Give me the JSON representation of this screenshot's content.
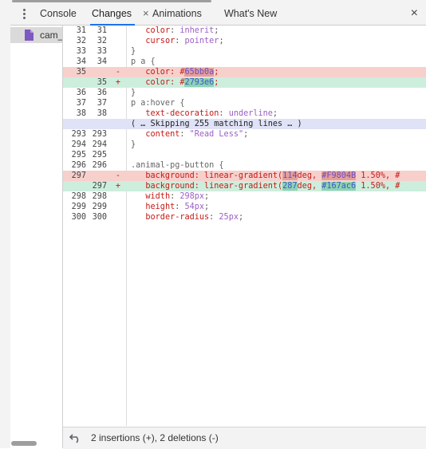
{
  "tabs": {
    "console": "Console",
    "changes": "Changes",
    "changes_close": "×",
    "animations": "Animations",
    "whats_new": "What's New",
    "panel_close": "×"
  },
  "sidebar": {
    "file_name": "cam_"
  },
  "diff_lines": [
    {
      "type": "context",
      "old": "31",
      "new": "31",
      "parts": [
        [
          "   ",
          ""
        ],
        [
          "color",
          "prop"
        ],
        [
          ": ",
          ""
        ],
        [
          "inherit",
          "val"
        ],
        [
          ";",
          ""
        ]
      ]
    },
    {
      "type": "context",
      "old": "32",
      "new": "32",
      "parts": [
        [
          "   ",
          ""
        ],
        [
          "cursor",
          "prop"
        ],
        [
          ": ",
          ""
        ],
        [
          "pointer",
          "val"
        ],
        [
          ";",
          ""
        ]
      ]
    },
    {
      "type": "context",
      "old": "33",
      "new": "33",
      "parts": [
        [
          "}",
          ""
        ]
      ]
    },
    {
      "type": "context",
      "old": "34",
      "new": "34",
      "parts": [
        [
          "p a {",
          "sel"
        ]
      ]
    },
    {
      "type": "del",
      "old": "35",
      "new": "",
      "marker": "-",
      "parts": [
        [
          "   color: #",
          ""
        ],
        [
          "65bb0a",
          "hl-del"
        ],
        [
          ";",
          ""
        ]
      ]
    },
    {
      "type": "add",
      "old": "",
      "new": "35",
      "marker": "+",
      "parts": [
        [
          "   color: #",
          ""
        ],
        [
          "2793e6",
          "hl-add"
        ],
        [
          ";",
          ""
        ]
      ]
    },
    {
      "type": "context",
      "old": "36",
      "new": "36",
      "parts": [
        [
          "}",
          ""
        ]
      ]
    },
    {
      "type": "context",
      "old": "37",
      "new": "37",
      "parts": [
        [
          "p a:hover {",
          "sel"
        ]
      ]
    },
    {
      "type": "context",
      "old": "38",
      "new": "38",
      "parts": [
        [
          "   ",
          ""
        ],
        [
          "text-decoration",
          "prop"
        ],
        [
          ": ",
          ""
        ],
        [
          "underline",
          "val"
        ],
        [
          ";",
          ""
        ]
      ]
    },
    {
      "type": "skip",
      "old": "",
      "new": "",
      "parts": [
        [
          "( … Skipping 255 matching lines … )",
          ""
        ]
      ]
    },
    {
      "type": "context",
      "old": "293",
      "new": "293",
      "parts": [
        [
          "   ",
          ""
        ],
        [
          "content",
          "prop"
        ],
        [
          ": ",
          ""
        ],
        [
          "\"Read Less\"",
          "str"
        ],
        [
          ";",
          ""
        ]
      ]
    },
    {
      "type": "context",
      "old": "294",
      "new": "294",
      "parts": [
        [
          "}",
          ""
        ]
      ]
    },
    {
      "type": "context",
      "old": "295",
      "new": "295",
      "parts": [
        [
          "",
          ""
        ]
      ]
    },
    {
      "type": "context",
      "old": "296",
      "new": "296",
      "parts": [
        [
          ".animal-pg-button {",
          "sel"
        ]
      ]
    },
    {
      "type": "del",
      "old": "297",
      "new": "",
      "marker": "-",
      "parts": [
        [
          "   background: linear-gradient(",
          ""
        ],
        [
          "114",
          "hl-del"
        ],
        [
          "deg, ",
          ""
        ],
        [
          "#F9804B",
          "hl-del"
        ],
        [
          " 1.50%, #",
          ""
        ]
      ]
    },
    {
      "type": "add",
      "old": "",
      "new": "297",
      "marker": "+",
      "parts": [
        [
          "   background: linear-gradient(",
          ""
        ],
        [
          "287",
          "hl-add"
        ],
        [
          "deg, ",
          ""
        ],
        [
          "#167ac6",
          "hl-add"
        ],
        [
          " 1.50%, #",
          ""
        ]
      ]
    },
    {
      "type": "context",
      "old": "298",
      "new": "298",
      "parts": [
        [
          "   ",
          ""
        ],
        [
          "width",
          "prop"
        ],
        [
          ": ",
          ""
        ],
        [
          "298px",
          "val"
        ],
        [
          ";",
          ""
        ]
      ]
    },
    {
      "type": "context",
      "old": "299",
      "new": "299",
      "parts": [
        [
          "   ",
          ""
        ],
        [
          "height",
          "prop"
        ],
        [
          ": ",
          ""
        ],
        [
          "54px",
          "val"
        ],
        [
          ";",
          ""
        ]
      ]
    },
    {
      "type": "context",
      "old": "300",
      "new": "300",
      "parts": [
        [
          "   ",
          ""
        ],
        [
          "border-radius",
          "prop"
        ],
        [
          ": ",
          ""
        ],
        [
          "25px",
          "val"
        ],
        [
          ";",
          ""
        ]
      ]
    }
  ],
  "footer": {
    "summary": "2 insertions (+), 2 deletions (-)"
  },
  "icons": {
    "kebab": "more-vertical-icon",
    "file": "document-icon",
    "revert": "undo-icon"
  },
  "colors": {
    "accent": "#1a73e8",
    "deleted_bg": "#f7d0cc",
    "added_bg": "#cdeedd",
    "skip_bg": "#e0e3f7",
    "file_icon": "#7e57c2"
  }
}
